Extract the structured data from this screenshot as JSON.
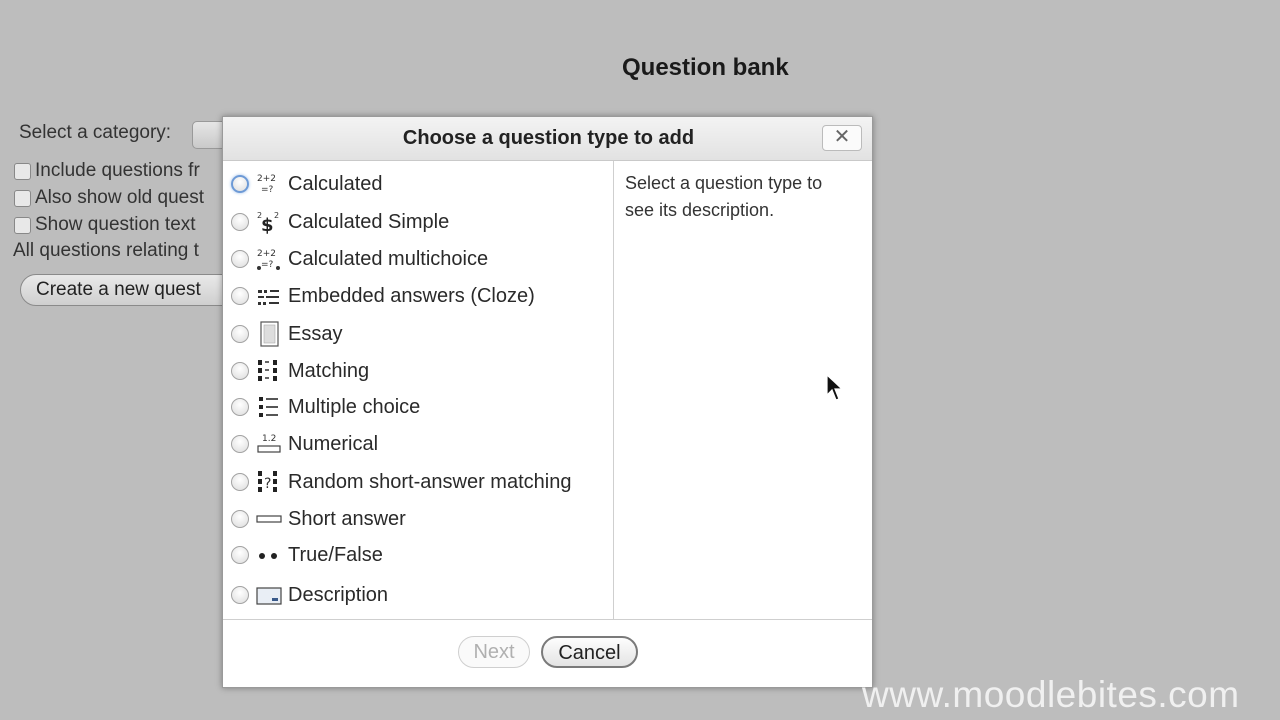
{
  "page": {
    "title": "Question bank",
    "select_category_label": "Select a category:",
    "options": [
      "Include questions fr",
      "Also show old quest",
      "Show question text"
    ],
    "all_questions_text": "All questions relating t",
    "create_button_label": "Create a new quest"
  },
  "dialog": {
    "title": "Choose a question type to add",
    "close_label": "✕",
    "question_types": [
      {
        "label": "Calculated",
        "icon": "calculated-icon"
      },
      {
        "label": "Calculated Simple",
        "icon": "calculated-simple-icon"
      },
      {
        "label": "Calculated multichoice",
        "icon": "calculated-multichoice-icon"
      },
      {
        "label": "Embedded answers (Cloze)",
        "icon": "cloze-icon"
      },
      {
        "label": "Essay",
        "icon": "essay-icon"
      },
      {
        "label": "Matching",
        "icon": "matching-icon"
      },
      {
        "label": "Multiple choice",
        "icon": "multiple-choice-icon"
      },
      {
        "label": "Numerical",
        "icon": "numerical-icon"
      },
      {
        "label": "Random short-answer matching",
        "icon": "random-matching-icon"
      },
      {
        "label": "Short answer",
        "icon": "short-answer-icon"
      },
      {
        "label": "True/False",
        "icon": "true-false-icon"
      }
    ],
    "other_types": [
      {
        "label": "Description",
        "icon": "description-icon"
      }
    ],
    "description_text": "Select a question type to see its description.",
    "next_label": "Next",
    "cancel_label": "Cancel"
  },
  "watermark": "www.moodlebites.com",
  "colors": {
    "background": "#bdbdbd",
    "focus_ring": "#6d9ad6",
    "disabled_text": "#b0b0b0"
  }
}
